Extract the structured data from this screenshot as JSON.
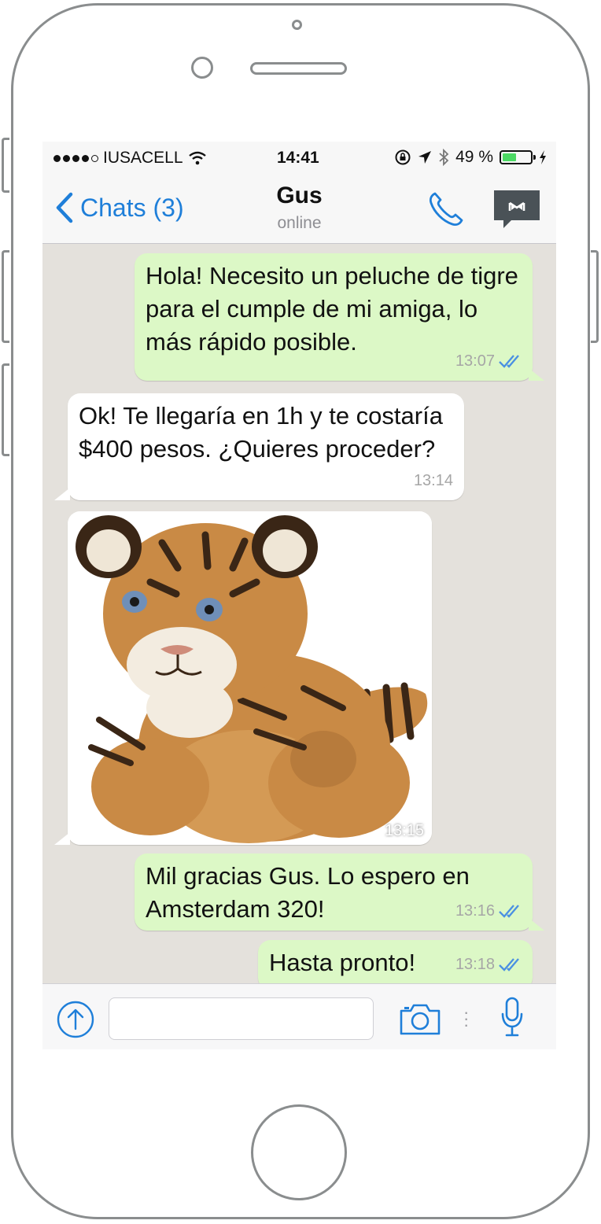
{
  "status_bar": {
    "carrier": "IUSACELL",
    "time": "14:41",
    "battery": "49 %",
    "battery_level": 0.49
  },
  "header": {
    "back_label": "Chats (3)",
    "contact_name": "Gus",
    "contact_status": "online"
  },
  "messages": [
    {
      "direction": "outgoing",
      "text": "Hola! Necesito un peluche de tigre para el cumple de mi amiga, lo más rápido posible.",
      "time": "13:07",
      "read": true
    },
    {
      "direction": "incoming",
      "text": "Ok! Te llegaría en 1h y te costaría $400 pesos. ¿Quieres proceder?",
      "time": "13:14"
    },
    {
      "direction": "incoming",
      "type": "image",
      "image_subject": "tiger plush toy",
      "time": "13:15"
    },
    {
      "direction": "outgoing",
      "text": "Mil gracias Gus. Lo espero en Amsterdam 320!",
      "time": "13:16",
      "read": true
    },
    {
      "direction": "outgoing",
      "text": "Hasta pronto!",
      "time": "13:18",
      "read": true
    }
  ],
  "colors": {
    "accent": "#1f7fd9",
    "outgoing_bubble": "#dcf8c6",
    "incoming_bubble": "#ffffff",
    "chat_background": "#e4e1dc",
    "read_ticks": "#4a90e2"
  },
  "icons": {
    "back": "chevron-left-icon",
    "call": "phone-icon",
    "contact_card": "contact-card-icon",
    "share": "share-upload-icon",
    "camera": "camera-icon",
    "mic": "microphone-icon"
  }
}
